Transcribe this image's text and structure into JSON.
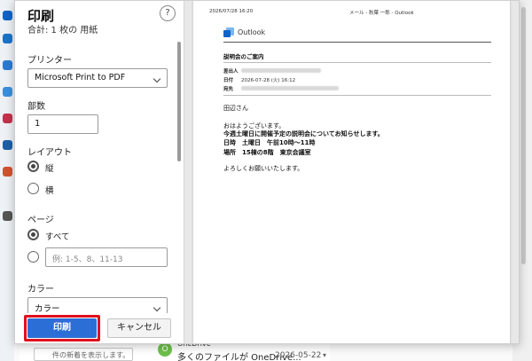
{
  "background": {
    "recent_button": "件の新着を表示します。",
    "item": {
      "avatar_letter": "O",
      "sender": "OneDrive",
      "subject": "多くのファイルが OneDrive...",
      "date": "2026-05-22"
    }
  },
  "dialog": {
    "title": "印刷",
    "subtitle": "合計: 1 枚の 用紙",
    "help_label": "?",
    "printer": {
      "label": "プリンター",
      "value": "Microsoft Print to PDF"
    },
    "copies": {
      "label": "部数",
      "value": "1"
    },
    "layout": {
      "label": "レイアウト",
      "portrait": "縦",
      "landscape": "横",
      "selected": "portrait"
    },
    "pages": {
      "label": "ページ",
      "all": "すべて",
      "custom_placeholder": "例: 1-5、8、11-13",
      "selected": "all"
    },
    "color": {
      "label": "カラー",
      "value": "カラー"
    },
    "print_button": "印刷",
    "cancel_button": "キャンセル",
    "highlight_color": "#e0101e",
    "accent_color": "#2b6fd6"
  },
  "preview": {
    "print_date": "2026/07/28 16:20",
    "header": "メール - 秋葉 一郎 - Outlook",
    "app_name": "Outlook",
    "subject": "説明会のご案内",
    "meta": {
      "from_label": "差出人",
      "date_label": "日付",
      "date_value": "2026-07-28 (火) 16:12",
      "to_label": "宛先"
    },
    "body": {
      "greeting": "田辺さん",
      "line1": "おはようございます。",
      "line2": "今週土曜日に開催予定の説明会についてお知らせします。",
      "line3": "日時　土曜日　午前10時～11時",
      "line4": "場所　15棟の8階　東京会議室",
      "closing": "よろしくお願いいたします。"
    }
  }
}
